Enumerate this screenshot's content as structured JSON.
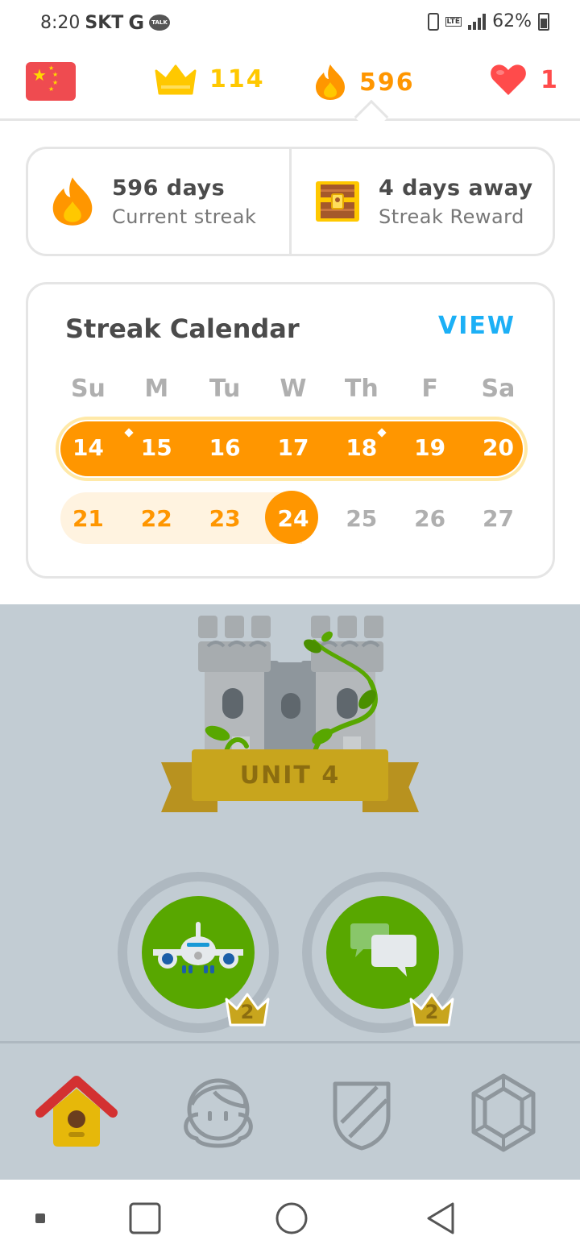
{
  "status_bar": {
    "time": "8:20",
    "carrier": "SKT",
    "g_label": "G",
    "talk_label": "TALK",
    "lte_label": "LTE",
    "battery": "62%"
  },
  "top_bar": {
    "language_flag": "china-flag-icon",
    "crowns": "114",
    "streak": "596",
    "hearts": "1",
    "colors": {
      "crown": "#ffc800",
      "streak": "#ff9600",
      "heart": "#ff4b4b"
    }
  },
  "streak_summary": {
    "streak_days": "596 days",
    "streak_label": "Current streak",
    "reward_days": "4 days away",
    "reward_label": "Streak Reward"
  },
  "calendar": {
    "title": "Streak Calendar",
    "view_label": "VIEW",
    "weekdays": [
      "Su",
      "M",
      "Tu",
      "W",
      "Th",
      "F",
      "Sa"
    ],
    "week1": [
      "14",
      "15",
      "16",
      "17",
      "18",
      "19",
      "20"
    ],
    "week2": [
      "21",
      "22",
      "23",
      "24",
      "25",
      "26",
      "27"
    ],
    "today": "24",
    "colors": {
      "streak": "#ff9600",
      "view": "#1cb0f6",
      "muted": "#afafaf"
    }
  },
  "unit": {
    "label": "UNIT 4"
  },
  "skills": [
    {
      "icon": "airplane-icon",
      "crown_level": "2"
    },
    {
      "icon": "chat-bubbles-icon",
      "crown_level": "2"
    }
  ],
  "tabs": [
    {
      "icon": "home-icon",
      "active": true
    },
    {
      "icon": "profile-icon",
      "active": false
    },
    {
      "icon": "leaderboard-shield-icon",
      "active": false
    },
    {
      "icon": "shop-icon",
      "active": false
    }
  ],
  "nav": [
    "menu-dot-icon",
    "recents-icon",
    "home-circle-icon",
    "back-icon"
  ]
}
